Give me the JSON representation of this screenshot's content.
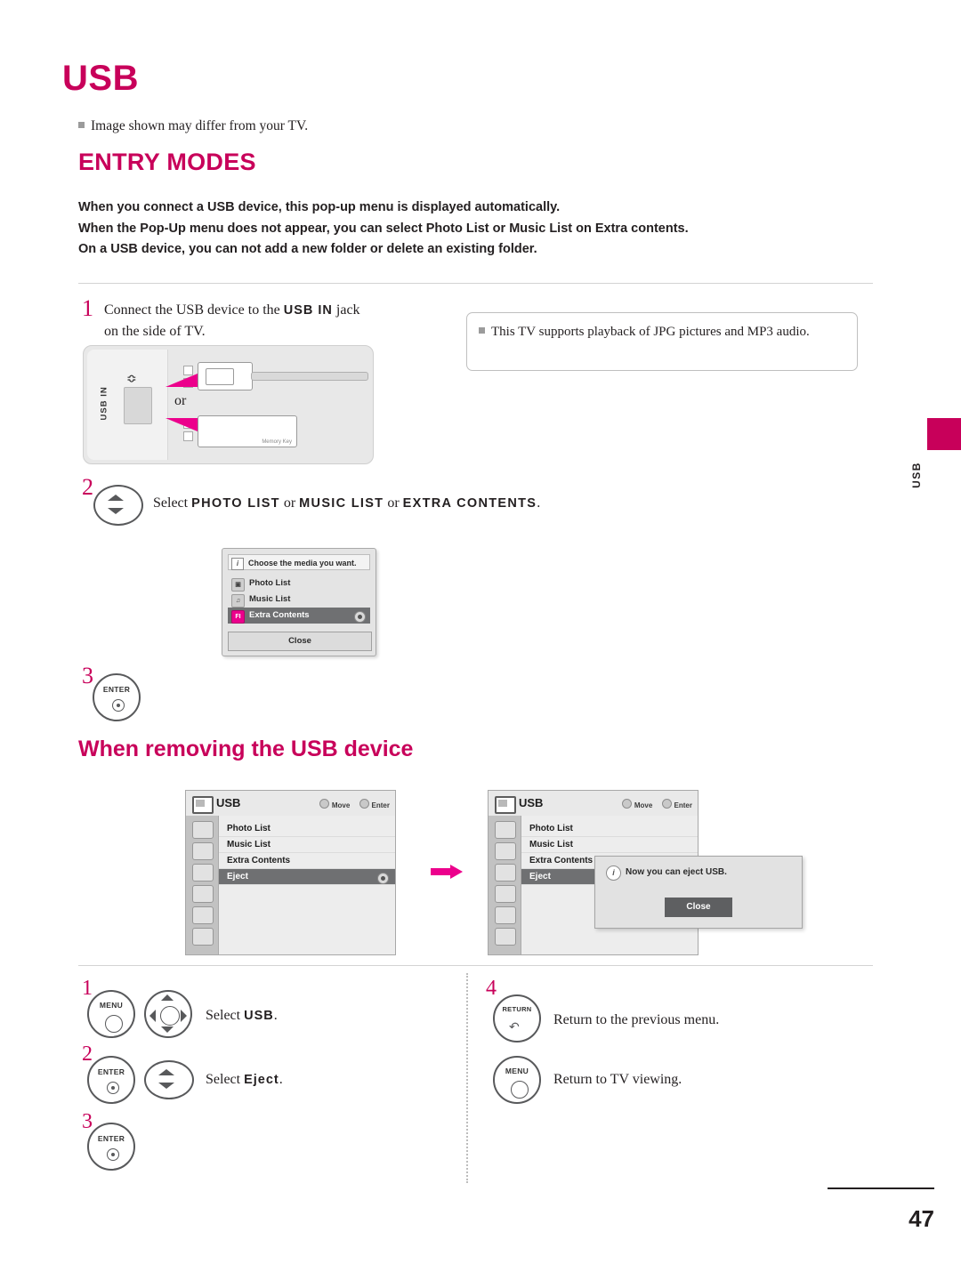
{
  "header": {
    "title": "USB",
    "note": "Image shown may differ from your TV.",
    "section_title": "ENTRY MODES",
    "intro_lines": [
      "When you connect a USB device, this pop-up menu is displayed automatically.",
      "When the Pop-Up menu does not appear, you can select Photo List or Music List on Extra contents.",
      "On a USB device, you can not add a new folder or delete an existing folder."
    ]
  },
  "steps": {
    "one": {
      "num": "1",
      "text_a": "Connect the USB device to the ",
      "bold": "USB IN",
      "text_b": " jack",
      "text_c": "on the side of TV."
    },
    "two": {
      "num": "2",
      "lead": "Select ",
      "opt1": "PHOTO LIST",
      "or1": " or ",
      "opt2": "MUSIC LIST",
      "or2": " or ",
      "opt3": "EXTRA CONTENTS",
      "end": "."
    },
    "three": {
      "num": "3",
      "button": "ENTER"
    }
  },
  "callout": {
    "text": "This TV supports playback of JPG pictures and MP3 audio."
  },
  "jack": {
    "label": "USB IN",
    "or": "or",
    "memory_key": "Memory Key"
  },
  "popup_media": {
    "header": "Choose the media you want.",
    "info_icon": "i",
    "items": [
      {
        "label": "Photo List",
        "icon": "photo-icon",
        "glyph": "▣",
        "selected": false
      },
      {
        "label": "Music List",
        "icon": "music-icon",
        "glyph": "♫",
        "selected": false
      },
      {
        "label": "Extra Contents",
        "icon": "file-icon",
        "glyph": "FI",
        "selected": true
      }
    ],
    "close": "Close"
  },
  "removing": {
    "heading": "When removing the USB device"
  },
  "screen_left": {
    "title": "USB",
    "hint_move": "Move",
    "hint_enter": "Enter",
    "rows": [
      {
        "label": "Photo List",
        "selected": false
      },
      {
        "label": "Music List",
        "selected": false
      },
      {
        "label": "Extra Contents",
        "selected": false
      },
      {
        "label": "Eject",
        "selected": true
      }
    ]
  },
  "screen_right": {
    "title": "USB",
    "hint_move": "Move",
    "hint_enter": "Enter",
    "rows": [
      {
        "label": "Photo List",
        "selected": false
      },
      {
        "label": "Music List",
        "selected": false
      },
      {
        "label": "Extra Contents",
        "selected": false
      },
      {
        "label": "Eject",
        "selected": true
      }
    ],
    "popup": {
      "message": "Now you can eject USB.",
      "close": "Close",
      "info_icon": "i"
    }
  },
  "bottom_left": [
    {
      "num": "1",
      "buttons": [
        "MENU",
        "dpad"
      ],
      "text_lead": "Select ",
      "text_bold": "USB",
      "text_end": "."
    },
    {
      "num": "2",
      "buttons": [
        "ENTER",
        "updown"
      ],
      "text_lead": "Select ",
      "text_bold": "Eject",
      "text_end": "."
    },
    {
      "num": "3",
      "buttons": [
        "ENTER"
      ],
      "text_lead": "",
      "text_bold": "",
      "text_end": ""
    }
  ],
  "bottom_right": [
    {
      "num": "4",
      "button": "RETURN",
      "text": "Return to the previous menu."
    },
    {
      "num": "",
      "button": "MENU",
      "text": "Return to TV viewing."
    }
  ],
  "side": {
    "tab_label": "USB"
  },
  "footer": {
    "page": "47"
  },
  "colors": {
    "brand": "#C8005A",
    "accent_pink": "#EC008C",
    "text": "#231F20",
    "selected_row": "#6F7072"
  }
}
